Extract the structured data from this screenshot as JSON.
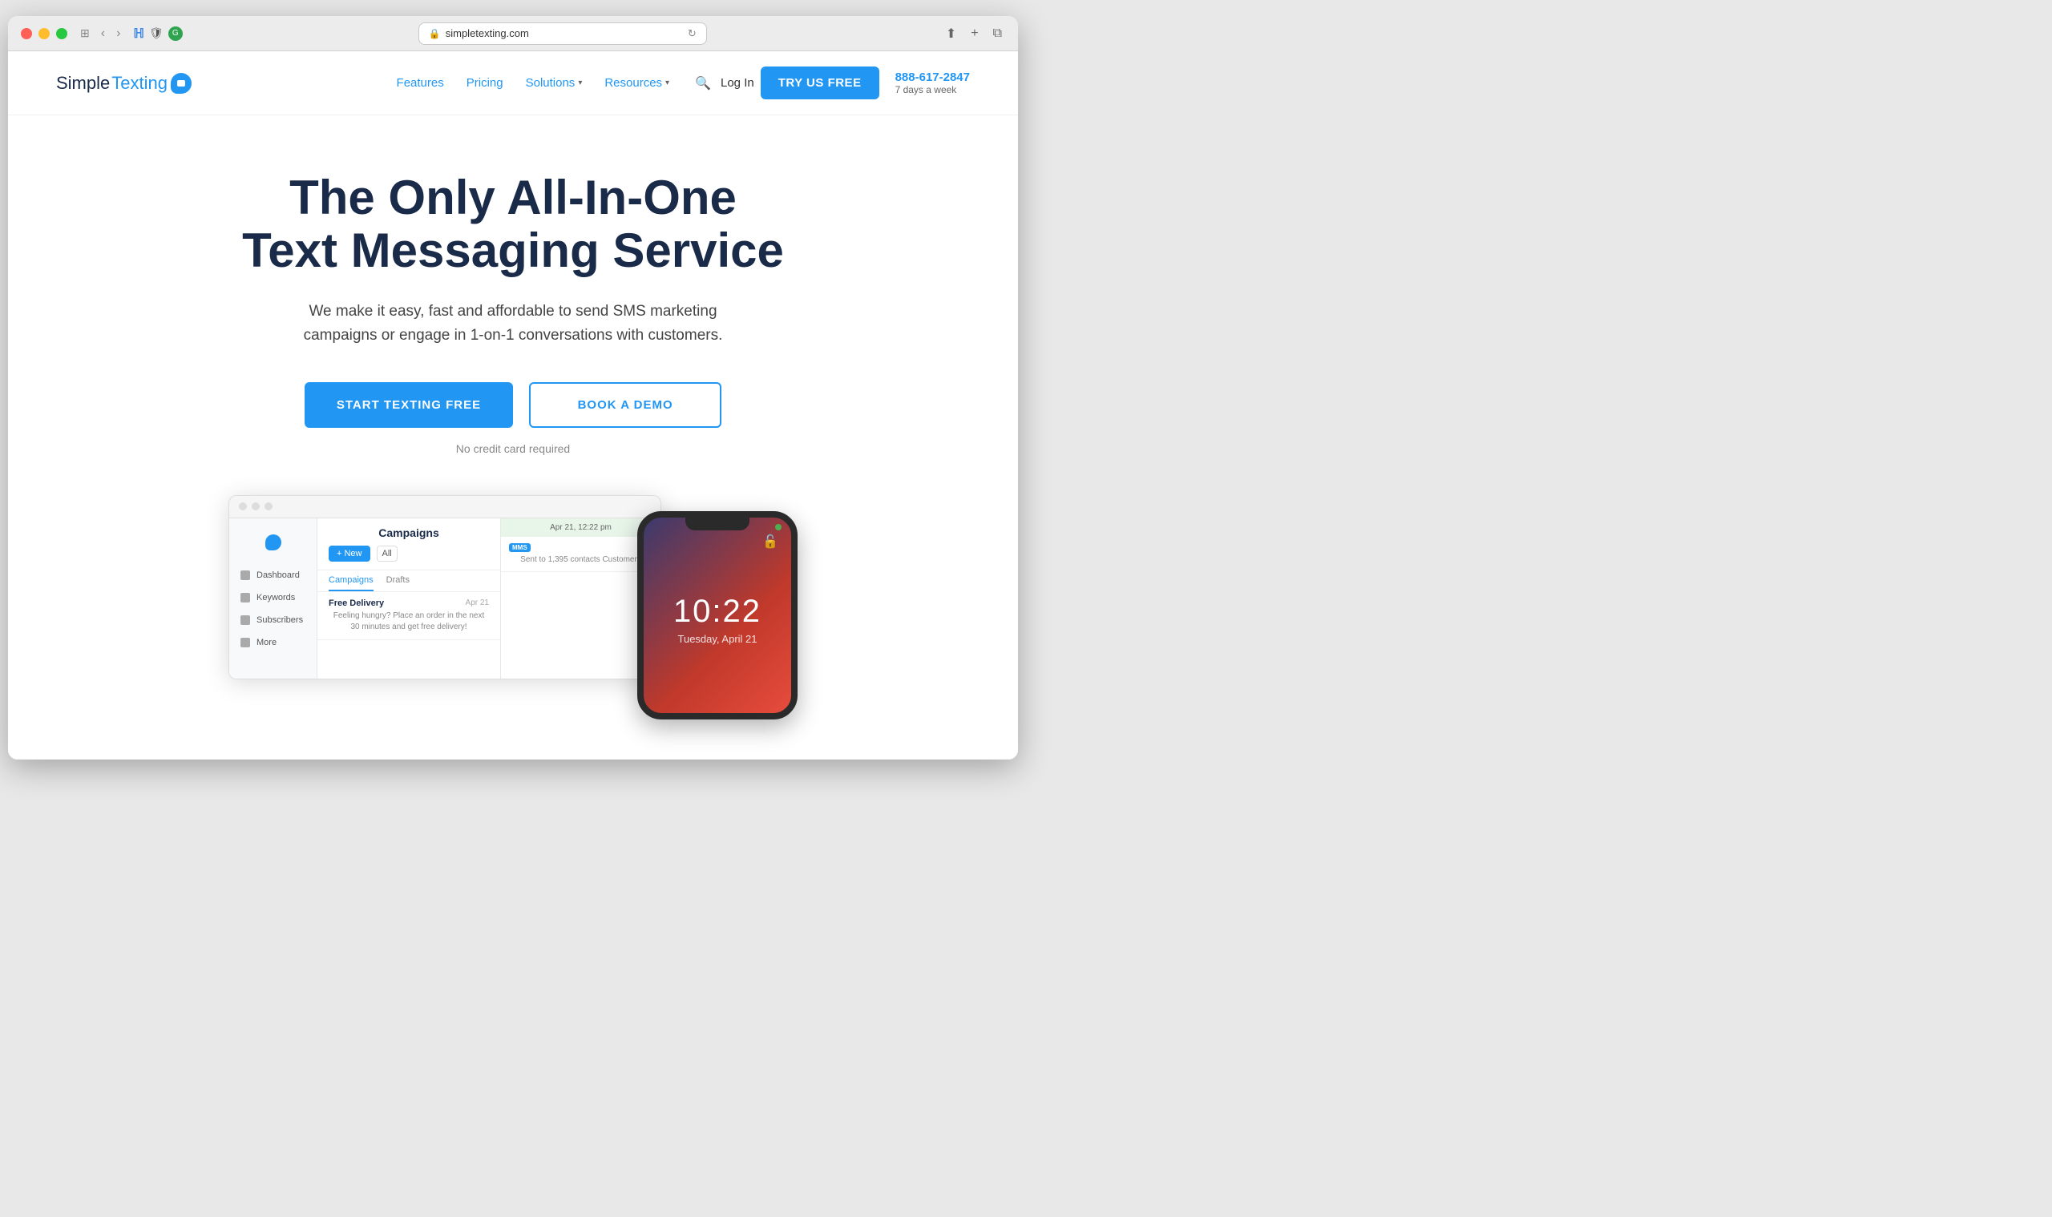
{
  "browser": {
    "url": "simpletexting.com",
    "tab_icon": "🔒"
  },
  "navbar": {
    "logo": {
      "text_simple": "Simple",
      "text_texting": "Texting"
    },
    "links": [
      {
        "label": "Features",
        "has_dropdown": false
      },
      {
        "label": "Pricing",
        "has_dropdown": false
      },
      {
        "label": "Solutions",
        "has_dropdown": true
      },
      {
        "label": "Resources",
        "has_dropdown": true
      }
    ],
    "login_label": "Log In",
    "cta_label": "TRY US FREE",
    "phone_number": "888-617-2847",
    "phone_sub": "7 days a week"
  },
  "hero": {
    "title_line1": "The Only All-In-One",
    "title_line2": "Text Messaging Service",
    "subtitle": "We make it easy, fast and affordable to send SMS marketing campaigns or engage in 1-on-1 conversations with customers.",
    "btn_primary": "START TEXTING FREE",
    "btn_secondary": "BOOK A DEMO",
    "note": "No credit card required"
  },
  "app_preview": {
    "title": "Campaigns",
    "btn_new": "+ New",
    "dropdown_all": "All",
    "tabs": [
      "Campaigns",
      "Drafts"
    ],
    "campaigns": [
      {
        "name": "Free Delivery",
        "date": "Apr 21",
        "desc": "Feeling hungry? Place an order in the next 30 minutes and get free delivery!"
      }
    ],
    "inbox": {
      "header": "Apr 21, 12:22 pm",
      "messages": [
        {
          "title": "MMS",
          "detail": "Sent to 1,395 contacts\nCustomers"
        }
      ]
    }
  },
  "phone": {
    "time": "10:22",
    "date": "Tuesday, April 21"
  },
  "sidebar_items": [
    {
      "label": "Dashboard"
    },
    {
      "label": "Keywords"
    },
    {
      "label": "Subscribers"
    },
    {
      "label": "More"
    }
  ]
}
